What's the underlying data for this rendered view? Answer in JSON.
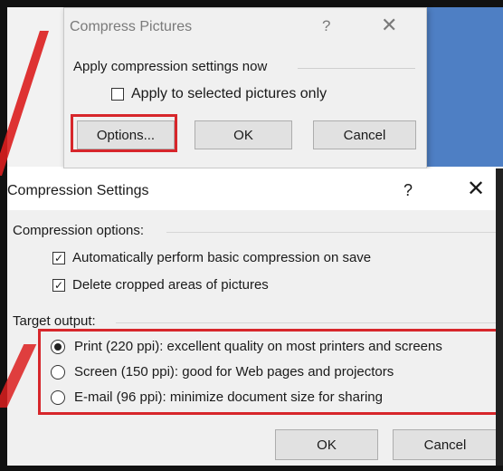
{
  "compress_dialog": {
    "title": "Compress Pictures",
    "help": "?",
    "close": "✕",
    "section_label": "Apply compression settings now",
    "apply_selected": {
      "label": "Apply to selected pictures only",
      "checked": false
    },
    "buttons": {
      "options": "Options...",
      "ok": "OK",
      "cancel": "Cancel"
    }
  },
  "settings_dialog": {
    "title": "Compression Settings",
    "help": "?",
    "close": "✕",
    "compression_options_label": "Compression options:",
    "auto_compress": {
      "label": "Automatically perform basic compression on save",
      "checked": true
    },
    "delete_cropped": {
      "label": "Delete cropped areas of pictures",
      "checked": true
    },
    "target_output_label": "Target output:",
    "targets": [
      {
        "label": "Print (220 ppi): excellent quality on most printers and screens",
        "selected": true
      },
      {
        "label": "Screen (150 ppi): good for Web pages and projectors",
        "selected": false
      },
      {
        "label": "E-mail (96 ppi): minimize document size for sharing",
        "selected": false
      }
    ],
    "buttons": {
      "ok": "OK",
      "cancel": "Cancel"
    }
  },
  "colors": {
    "highlight": "#d7262b",
    "dialog_bg": "#f0f0f0",
    "desktop_blue": "#4e7fc4"
  }
}
